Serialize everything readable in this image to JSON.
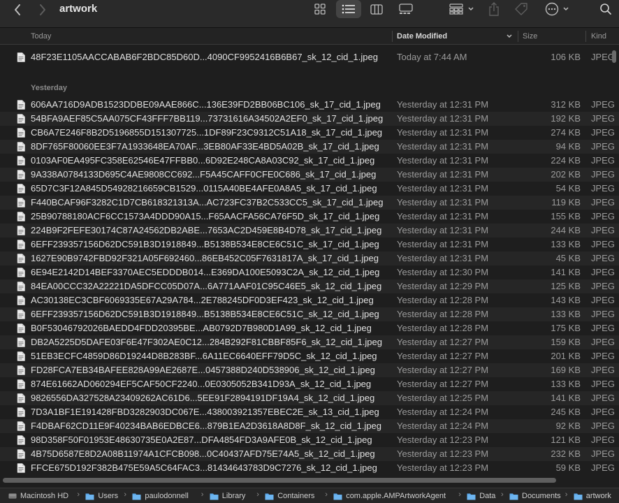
{
  "window": {
    "title": "artwork"
  },
  "header": {
    "name": "Today",
    "date": "Date Modified",
    "size": "Size",
    "kind": "Kind"
  },
  "sections": {
    "today": "Today",
    "yesterday": "Yesterday"
  },
  "today_files": [
    {
      "name": "48F23E1105AACCABAB6F2BDC85D60D...4090CF9952416B6B67_sk_12_cid_1.jpeg",
      "date": "Today at 7:44 AM",
      "size": "106 KB",
      "kind": "JPEG"
    }
  ],
  "yesterday_files": [
    {
      "name": "606AA716D9ADB1523DDBE09AAE866C...136E39FD2BB06BC106_sk_17_cid_1.jpeg",
      "date": "Yesterday at 12:31 PM",
      "size": "312 KB",
      "kind": "JPEG"
    },
    {
      "name": "54BFA9AEF85C5AA075CF43FFF7BB119...73731616A34502A2EF0_sk_17_cid_1.jpeg",
      "date": "Yesterday at 12:31 PM",
      "size": "192 KB",
      "kind": "JPEG"
    },
    {
      "name": "CB6A7E246F8B2D5196855D151307725...1DF89F23C9312C51A18_sk_17_cid_1.jpeg",
      "date": "Yesterday at 12:31 PM",
      "size": "274 KB",
      "kind": "JPEG"
    },
    {
      "name": "8DF765F80060EE3F7A1933648EA70AF...3EB80AF33E4BD5A02B_sk_17_cid_1.jpeg",
      "date": "Yesterday at 12:31 PM",
      "size": "94 KB",
      "kind": "JPEG"
    },
    {
      "name": "0103AF0EA495FC358E62546E47FFBB0...6D92E248CA8A03C92_sk_17_cid_1.jpeg",
      "date": "Yesterday at 12:31 PM",
      "size": "224 KB",
      "kind": "JPEG"
    },
    {
      "name": "9A338A0784133D695C4AE9808CC692...F5A45CAFF0CFE0C686_sk_17_cid_1.jpeg",
      "date": "Yesterday at 12:31 PM",
      "size": "202 KB",
      "kind": "JPEG"
    },
    {
      "name": "65D7C3F12A845D54928216659CB1529...0115A40BE4AFE0A8A5_sk_17_cid_1.jpeg",
      "date": "Yesterday at 12:31 PM",
      "size": "54 KB",
      "kind": "JPEG"
    },
    {
      "name": "F440BCAF96F3282C1D7CB618321313A...AC723FC37B2C533CC5_sk_17_cid_1.jpeg",
      "date": "Yesterday at 12:31 PM",
      "size": "119 KB",
      "kind": "JPEG"
    },
    {
      "name": "25B90788180ACF6CC1573A4DDD90A15...F65AACFA56CA76F5D_sk_17_cid_1.jpeg",
      "date": "Yesterday at 12:31 PM",
      "size": "155 KB",
      "kind": "JPEG"
    },
    {
      "name": "224B9F2FEFE30174C87A24562DB2ABE...7653AC2D459E8B4D78_sk_17_cid_1.jpeg",
      "date": "Yesterday at 12:31 PM",
      "size": "244 KB",
      "kind": "JPEG"
    },
    {
      "name": "6EFF239357156D62DC591B3D1918849...B5138B534E8CE6C51C_sk_17_cid_1.jpeg",
      "date": "Yesterday at 12:31 PM",
      "size": "133 KB",
      "kind": "JPEG"
    },
    {
      "name": "1627E90B9742FBD92F321A05F692460...86EB452C05F7631817A_sk_17_cid_1.jpeg",
      "date": "Yesterday at 12:31 PM",
      "size": "45 KB",
      "kind": "JPEG"
    },
    {
      "name": "6E94E2142D14BEF3370AEC5EDDDB014...E369DA100E5093C2A_sk_12_cid_1.jpeg",
      "date": "Yesterday at 12:30 PM",
      "size": "141 KB",
      "kind": "JPEG"
    },
    {
      "name": "84EA00CCC32A22221DA5DFCC05D07A...6A771AAF01C95C46E5_sk_12_cid_1.jpeg",
      "date": "Yesterday at 12:29 PM",
      "size": "125 KB",
      "kind": "JPEG"
    },
    {
      "name": "AC30138EC3CBF6069335E67A29A784...2E788245DF0D3EF423_sk_12_cid_1.jpeg",
      "date": "Yesterday at 12:28 PM",
      "size": "143 KB",
      "kind": "JPEG"
    },
    {
      "name": "6EFF239357156D62DC591B3D1918849...B5138B534E8CE6C51C_sk_12_cid_1.jpeg",
      "date": "Yesterday at 12:28 PM",
      "size": "133 KB",
      "kind": "JPEG"
    },
    {
      "name": "B0F53046792026BAEDD4FDD20395BE...AB0792D7B980D1A99_sk_12_cid_1.jpeg",
      "date": "Yesterday at 12:28 PM",
      "size": "175 KB",
      "kind": "JPEG"
    },
    {
      "name": "DB2A5225D5DAFE03F6E47F302AE0C12...284B292F81CBBF85F6_sk_12_cid_1.jpeg",
      "date": "Yesterday at 12:27 PM",
      "size": "159 KB",
      "kind": "JPEG"
    },
    {
      "name": "51EB3ECFC4859D86D19244D8B283BF...6A11EC6640EFF79D5C_sk_12_cid_1.jpeg",
      "date": "Yesterday at 12:27 PM",
      "size": "201 KB",
      "kind": "JPEG"
    },
    {
      "name": "FD28FCA7EB34BAFEE828A99AE2687E...0457388D240D538906_sk_12_cid_1.jpeg",
      "date": "Yesterday at 12:27 PM",
      "size": "169 KB",
      "kind": "JPEG"
    },
    {
      "name": "874E61662AD060294EF5CAF50CF2240...0E0305052B341D93A_sk_12_cid_1.jpeg",
      "date": "Yesterday at 12:27 PM",
      "size": "133 KB",
      "kind": "JPEG"
    },
    {
      "name": "9826556DA327528A23409262AC61D6...5EE91F2894191DF19A4_sk_12_cid_1.jpeg",
      "date": "Yesterday at 12:25 PM",
      "size": "141 KB",
      "kind": "JPEG"
    },
    {
      "name": "7D3A1BF1E191428FBD3282903DC067E...438003921357EBEC2E_sk_13_cid_1.jpeg",
      "date": "Yesterday at 12:24 PM",
      "size": "245 KB",
      "kind": "JPEG"
    },
    {
      "name": "F4DBAF62CD11E9F40234BAB6EDBCE6...879B1EA2D3618A8D8F_sk_12_cid_1.jpeg",
      "date": "Yesterday at 12:24 PM",
      "size": "92 KB",
      "kind": "JPEG"
    },
    {
      "name": "98D358F50F01953E48630735E0A2E87...DFA4854FD3A9AFE0B_sk_12_cid_1.jpeg",
      "date": "Yesterday at 12:23 PM",
      "size": "121 KB",
      "kind": "JPEG"
    },
    {
      "name": "4B75D6587E8D2A08B11974A1CFCB098...0C40437AFD75E74A5_sk_12_cid_1.jpeg",
      "date": "Yesterday at 12:23 PM",
      "size": "232 KB",
      "kind": "JPEG"
    },
    {
      "name": "FFCE675D192F382B475E59A5C64FAC3...81434643783D9C7276_sk_12_cid_1.jpeg",
      "date": "Yesterday at 12:23 PM",
      "size": "59 KB",
      "kind": "JPEG"
    }
  ],
  "pathbar": [
    {
      "label": "Macintosh HD",
      "icon": "disk-icon"
    },
    {
      "label": "Users",
      "icon": "folder-icon"
    },
    {
      "label": "paulodonnell",
      "icon": "folder-icon"
    },
    {
      "label": "Library",
      "icon": "folder-icon"
    },
    {
      "label": "Containers",
      "icon": "folder-icon"
    },
    {
      "label": "com.apple.AMPArtworkAgent",
      "icon": "folder-icon"
    },
    {
      "label": "Data",
      "icon": "folder-icon"
    },
    {
      "label": "Documents",
      "icon": "folder-icon"
    },
    {
      "label": "artwork",
      "icon": "folder-icon"
    }
  ],
  "colors": {
    "accent": "#4a9eed",
    "folder": "#5aa7e8",
    "background": "#1e1e1e"
  }
}
